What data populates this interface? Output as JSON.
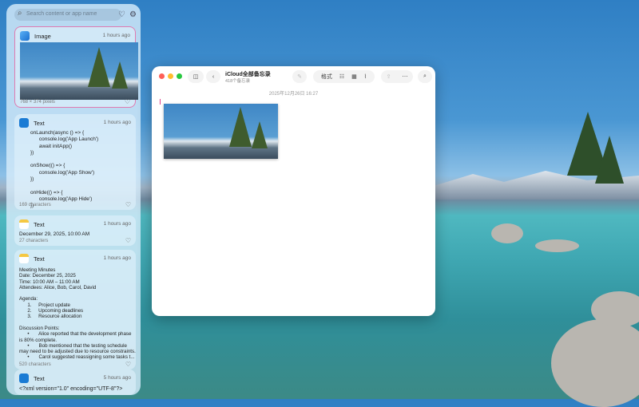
{
  "panel": {
    "search_placeholder": "Search content or app name",
    "cards": [
      {
        "type": "Image",
        "time": "1 hours ago",
        "footer": "768 × 374 pixels"
      },
      {
        "type": "Text",
        "time": "1 hours ago",
        "content": "onLaunch(async () => {\n      console.log('App Launch')\n      await initApp()\n})\n\nonShow(() => {\n      console.log('App Show')\n})\n\nonHide(() => {\n      console.log('App Hide')\n})",
        "footer": "169 characters"
      },
      {
        "type": "Text",
        "time": "1 hours ago",
        "content": "December 29, 2025, 10:00 AM",
        "footer": "27 characters"
      },
      {
        "type": "Text",
        "time": "1 hours ago",
        "content": "Meeting Minutes\nDate: December 25, 2025\nTime: 10:00 AM – 11:00 AM\nAttendees: Alice, Bob, Carol, David\n\nAgenda:\n      1.     Project update\n      2.     Upcoming deadlines\n      3.     Resource allocation\n\nDiscussion Points:\n      •       Alice reported that the development phase\nis 80% complete.\n      •       Bob mentioned that the testing schedule\nmay need to be adjusted due to resource constraints.\n      •       Carol suggested reassigning some tasks t...",
        "footer": "520 characters"
      },
      {
        "type": "Text",
        "time": "5 hours ago",
        "content": "<?xml version=\"1.0\" encoding=\"UTF-8\"?>"
      }
    ]
  },
  "notes": {
    "title": "iCloud全部备忘录",
    "subtitle": "418个备忘录",
    "format_label": "格式",
    "date": "2025年12月26日 16:27"
  }
}
